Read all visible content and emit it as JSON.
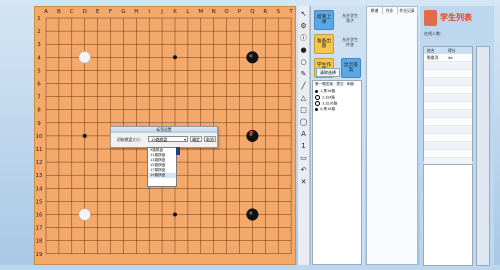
{
  "board": {
    "columns": [
      "A",
      "B",
      "C",
      "D",
      "E",
      "F",
      "G",
      "H",
      "I",
      "J",
      "K",
      "L",
      "M",
      "N",
      "O",
      "P",
      "Q",
      "R",
      "S",
      "T"
    ],
    "rows": [
      "1",
      "2",
      "3",
      "4",
      "5",
      "6",
      "7",
      "8",
      "9",
      "10",
      "11",
      "12",
      "13",
      "14",
      "15",
      "16",
      "17",
      "18",
      "19"
    ],
    "stones": [
      {
        "color": "white",
        "col": "D",
        "row": "4"
      },
      {
        "color": "black",
        "col": "Q",
        "row": "4"
      },
      {
        "color": "black",
        "col": "Q",
        "row": "10",
        "highlight": true
      },
      {
        "color": "white",
        "col": "D",
        "row": "16"
      },
      {
        "color": "black",
        "col": "Q",
        "row": "16"
      }
    ],
    "star_points": [
      [
        "K",
        "4"
      ],
      [
        "D",
        "10"
      ],
      [
        "K",
        "16"
      ]
    ]
  },
  "dialog": {
    "title": "标签设置",
    "label": "初始棋盘大小：",
    "selected": "19路棋盘",
    "ok": "确定",
    "cancel": "取消",
    "options": [
      "9路棋盘",
      "11路棋盘",
      "13路棋盘",
      "15路棋盘",
      "17路棋盘",
      "19路棋盘"
    ]
  },
  "controls": {
    "buttons": [
      {
        "label": "结束上课",
        "color": "#58a8e8"
      },
      {
        "label": "准备出题",
        "color": "#f5c64b"
      },
      {
        "label": "学生作答",
        "color": "#f5c64b"
      },
      {
        "label": "显示答案",
        "color": "#58a8e8"
      }
    ],
    "links": [
      "允许学生落子",
      "允许学生作答"
    ],
    "student_list_btn": "清除选择"
  },
  "list_header": "第一题答案 · 提交 · 刷新",
  "list_rows": [
    "1.黑16路",
    "2.白4路",
    "3.白16路",
    "4.黑16路"
  ],
  "mid_tabs": [
    "棋谱",
    "作业",
    "作业记录"
  ],
  "students": {
    "title": "学生列表",
    "count_label": "在线人数：",
    "headers": [
      "姓名",
      "得分"
    ],
    "rows": [
      [
        "陈俊洋",
        "4e"
      ]
    ]
  },
  "colors": {
    "board": "#f4a96a",
    "grid": "#6b3a12",
    "accent": "#2d7fd0"
  }
}
